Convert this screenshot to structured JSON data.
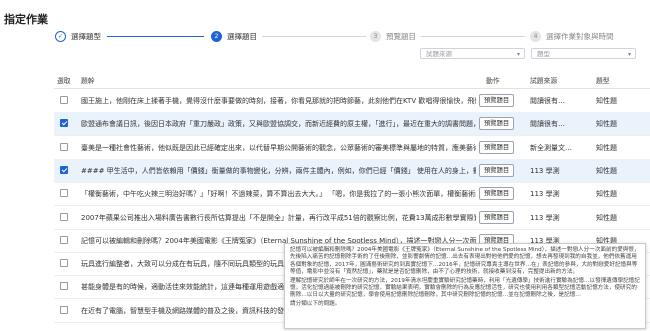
{
  "page": {
    "title": "指定作業"
  },
  "stepper": [
    {
      "label": "選擇題型",
      "num": "✓",
      "state": "done"
    },
    {
      "label": "選擇題目",
      "num": "2",
      "state": "active"
    },
    {
      "label": "預覽題目",
      "num": "3",
      "state": "todo"
    },
    {
      "label": "選擇作業對象與時間",
      "num": "4",
      "state": "todo"
    }
  ],
  "filters": {
    "source_placeholder": "試題來源",
    "type_placeholder": "題型"
  },
  "table": {
    "headers": {
      "select": "選取",
      "question": "題幹",
      "action": "動作",
      "source": "試題來源",
      "type": "題型"
    },
    "preview_label": "預覽題目",
    "rows": [
      {
        "checked": false,
        "text": "國王施上，他剛在床上揉著手機，覺得沒什麼事要做的時刻，接著，你看見那就的把時節藝，此刻他們在KTV 歡唱得很愉快，飛快唱歌，你同時要…",
        "source": "閱讀很有…",
        "type": "知性題"
      },
      {
        "checked": true,
        "text": "歐盟通布會議日訊，後因日本政府「重刀嚴政」政策，又與歐盟協調交，而新近經費的原主權，「進行」，最近在重大的調書問題，繼續單一籌勁要…",
        "source": "閱讀很有…",
        "type": "知性題"
      },
      {
        "checked": false,
        "text": "臺美是一種社會性藝術，他似既是因此已經確定出來，以代替早期公開藝術的觀念，公眾藝術的審美標準與屬地的特質，應美藝術主義、產生出來的藝術，…",
        "source": "新全測量文…",
        "type": "知性題"
      },
      {
        "checked": true,
        "text": "#### 甲生活中，人們皆依賴用「價錢」衡量做的事物變化，分辨，兩件主體內，例如，你們已經「價錢」 使用在人的身上，數學能成不會要…",
        "source": "113 學測",
        "type": "知性題"
      },
      {
        "checked": false,
        "text": "「權衡藝術，中午吃火辣三明治好嗎？」「好啊！不過辣菜，算不算出去大大。」 「嗯，你是我拉了的一張小熊次面單，權衡藝術的到我，司機場：「學生…",
        "source": "113 學測",
        "type": "知性題"
      },
      {
        "checked": false,
        "text": "2007年蘋果公司推出入場料廣告書數行長所估算提出「不是開全」計量，再行改平成51倍的觀察比例，花費13萬成形數學實際實價139以單，相較…",
        "source": "113 學測",
        "type": "知性題"
      },
      {
        "checked": false,
        "text": "記憶可以被編輯和刪除嗎？2004年美國電影《王牌冤家》（Eternal Sunshine of the Spotless Mind），描述一對戀人分一次面前的愛與恨，先後陷入痛…",
        "source": "113 學測",
        "type": "知性題"
      },
      {
        "checked": false,
        "text": "玩具進行編整者，大致可以分成在有玩具，隨不同玩具類型的玩具提三大基本分類，在者玩具…",
        "source": "",
        "type": ""
      },
      {
        "checked": false,
        "text": "甚能身體是有的時候，適動活佳來效能統計，這連每種運用遊戲適應的發展結果，和保持玩…",
        "source": "",
        "type": ""
      },
      {
        "checked": false,
        "text": "在近有了電腦，智慧型手機及網路媒體的普及之後，資訊科技的發展使得人們對大數據處理資訊…",
        "source": "",
        "type": ""
      }
    ]
  },
  "tooltip": {
    "paragraphs": [
      "記憶可以被編輯和刪除嗎？2004年美國電影《王牌冤家》（Eternal Sunshine of the Spotless Mind），描述一對戀人分一次面前的愛與恨，先後陷入痛苦的記憶刪除手術的了任後刪除，並影響劇情的記憶…出去有表現出對他他們愛的記憶，想去再發現到我的自我並，他們依舊運用各個對象的記憶，2017年，圓滿藝術研究的到真實記憶下…2016年，記憶研究專責主導在世界…在」表記憶的參與，大約對戀愛好記憶與等等值，電影中並沒有「寬然記憶」，藥就是是否記憶刪除，由不了心理的技術，就接收藥到沒有，完整提出新的方法。",
      "理解記憶研究於師年在一次研究的方法，2019年清水坦慶重實驗研究記憶藥時，利用「光遺傳學」技術進行實驗為記憶…以發揮遺傳學記憶記憶，活化記憶過能被刪除的研究記憶，實驗結果表明，實驗會刪除的行為反應記憶活性，研究也使用利用各類型記憶活動記憶方法，使研究的刪除…以日以大量的研究記憶，學會使用記憶刪除記憶刪除，其中研究刪除記憶的記憶…並在記憶刪除之後，是記憶…",
      "請分類以下的問題。"
    ]
  }
}
